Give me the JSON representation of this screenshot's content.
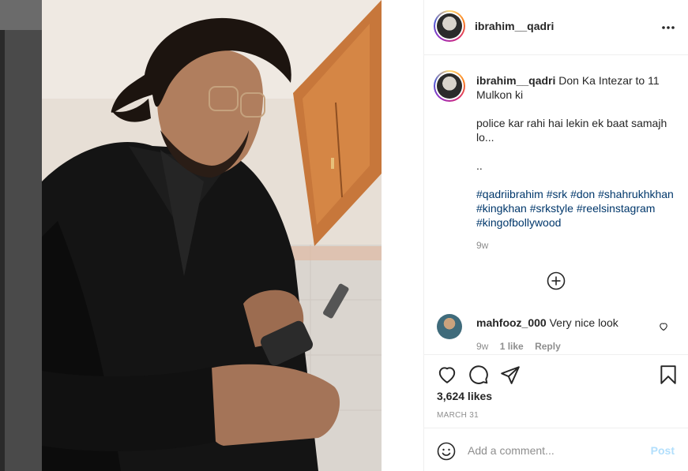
{
  "post": {
    "author": "ibrahim__qadri",
    "caption": {
      "first_line": "Don Ka Intezar to 11 Mulkon ki",
      "line2": "police kar rahi hai lekin ek baat samajh lo...",
      "line3": "..",
      "hashtags": [
        "#qadriibrahim",
        "#srk",
        "#don",
        "#shahrukhkhan",
        "#kingkhan",
        "#srkstyle",
        "#reelsinstagram",
        "#kingofbollywood"
      ]
    },
    "caption_age": "9w",
    "likes": "3,624 likes",
    "date": "MARCH 31"
  },
  "comments": [
    {
      "user": "mahfooz_000",
      "text": "Very nice look",
      "age": "9w",
      "likes": "1 like",
      "reply": "Reply"
    }
  ],
  "composer": {
    "placeholder": "Add a comment...",
    "post_label": "Post"
  },
  "icons": {
    "more": "more-options-icon",
    "load_more": "load-more-comments-icon",
    "like": "heart-icon",
    "comment": "comment-icon",
    "share": "share-icon",
    "save": "bookmark-icon",
    "emoji": "emoji-icon"
  },
  "colors": {
    "hashtag": "#00376b",
    "muted": "#8e8e8e",
    "post_disabled": "#b2dffc"
  }
}
